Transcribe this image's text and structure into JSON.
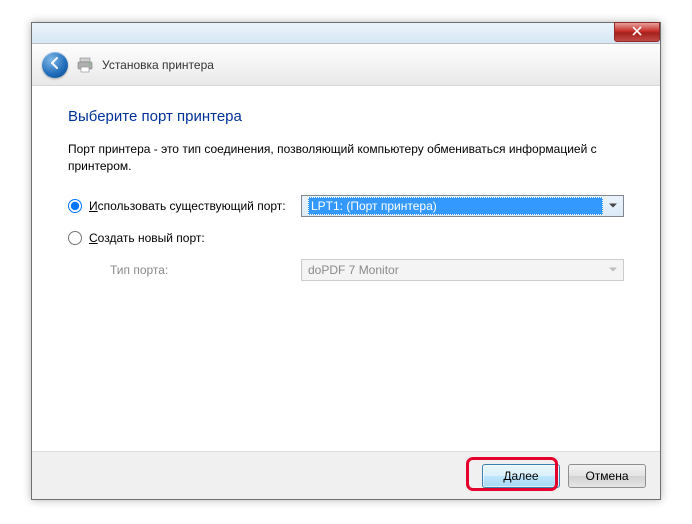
{
  "header": {
    "title": "Установка принтера"
  },
  "content": {
    "heading": "Выберите порт принтера",
    "description": "Порт принтера - это тип соединения, позволяющий компьютеру обмениваться информацией с принтером.",
    "option_existing": {
      "prefix": "И",
      "rest": "спользовать существующий порт:",
      "selected_value": "LPT1: (Порт принтера)"
    },
    "option_new": {
      "prefix": "С",
      "rest": "оздать новый порт:"
    },
    "port_type": {
      "label": "Тип порта:",
      "value": "doPDF 7 Monitor"
    }
  },
  "footer": {
    "next_prefix": "Д",
    "next_rest": "алее",
    "cancel": "Отмена"
  }
}
